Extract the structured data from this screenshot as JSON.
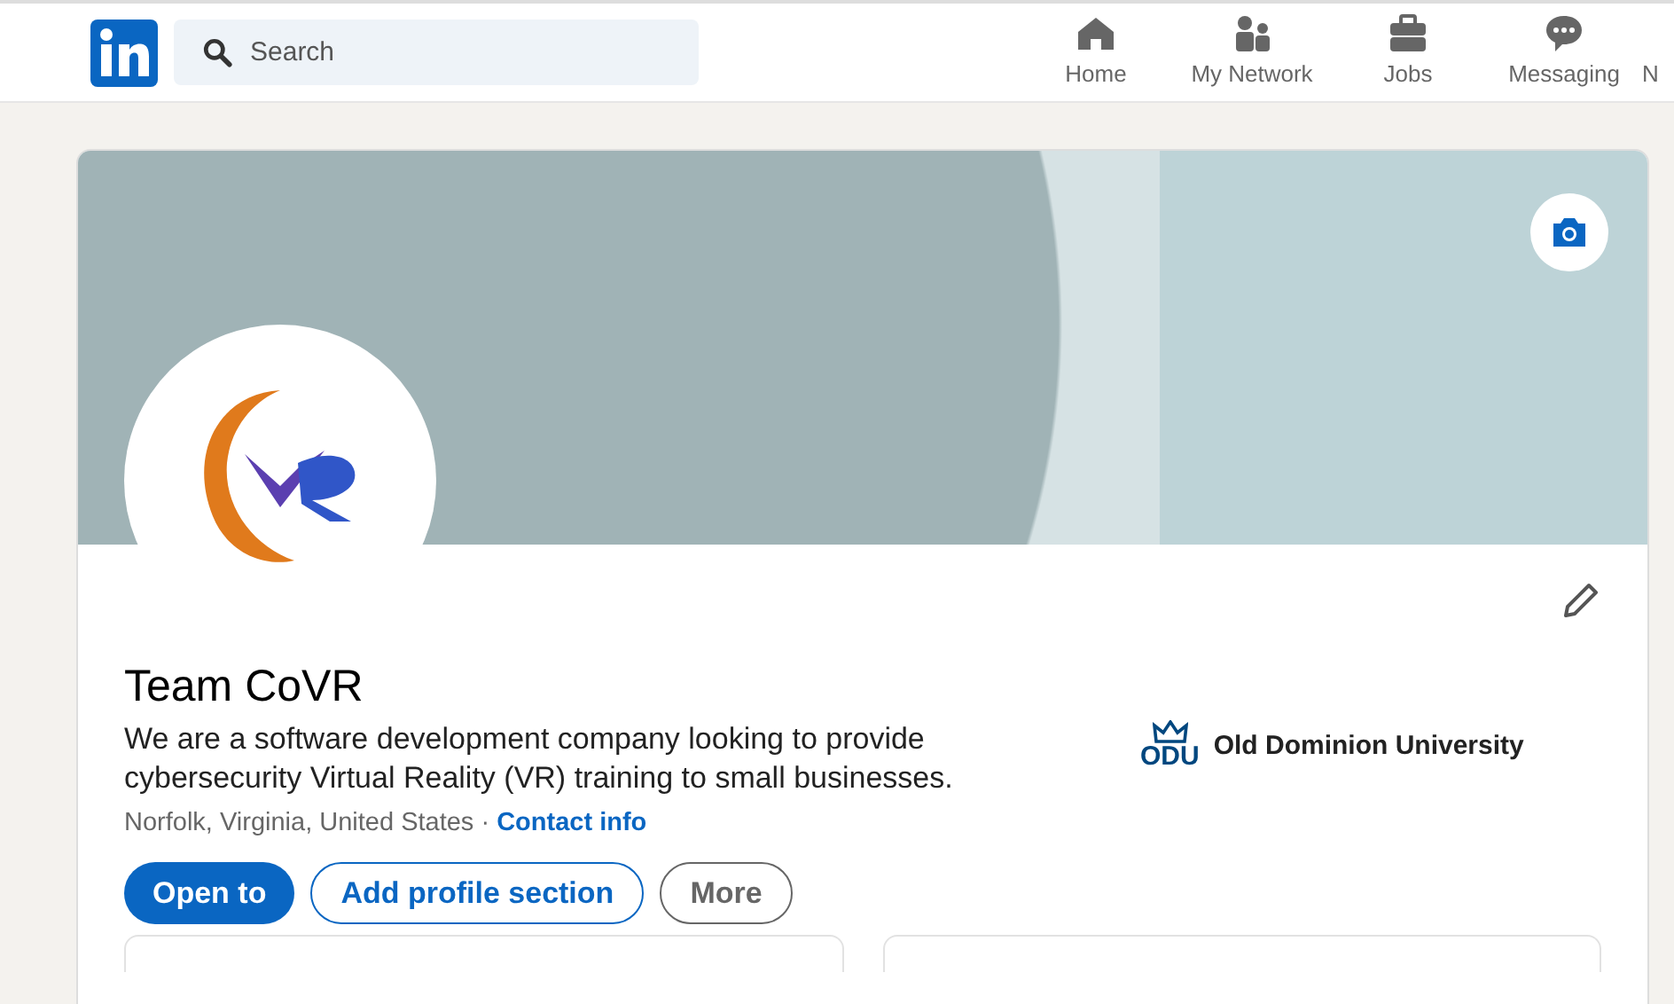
{
  "nav": {
    "search": {
      "placeholder": "Search"
    },
    "items": [
      {
        "label": "Home",
        "kind": "home",
        "selected": false
      },
      {
        "label": "My Network",
        "kind": "network",
        "selected": false
      },
      {
        "label": "Jobs",
        "kind": "jobs",
        "selected": false
      },
      {
        "label": "Messaging",
        "kind": "messaging",
        "selected": false
      },
      {
        "label": "N",
        "kind": "partial",
        "selected": false
      }
    ]
  },
  "profile": {
    "name": "Team CoVR",
    "headline": "We are a software development company looking to provide cybersecurity Virtual Reality (VR) training to small businesses.",
    "location": "Norfolk, Virginia, United States",
    "separator": "·",
    "contact_link": "Contact info",
    "education": {
      "logo_text": "ODU",
      "name": "Old Dominion University"
    }
  },
  "buttons": [
    {
      "label": "Open to",
      "kind": "primary"
    },
    {
      "label": "Add profile section",
      "kind": "secondary"
    },
    {
      "label": "More",
      "kind": "tertiary"
    }
  ]
}
